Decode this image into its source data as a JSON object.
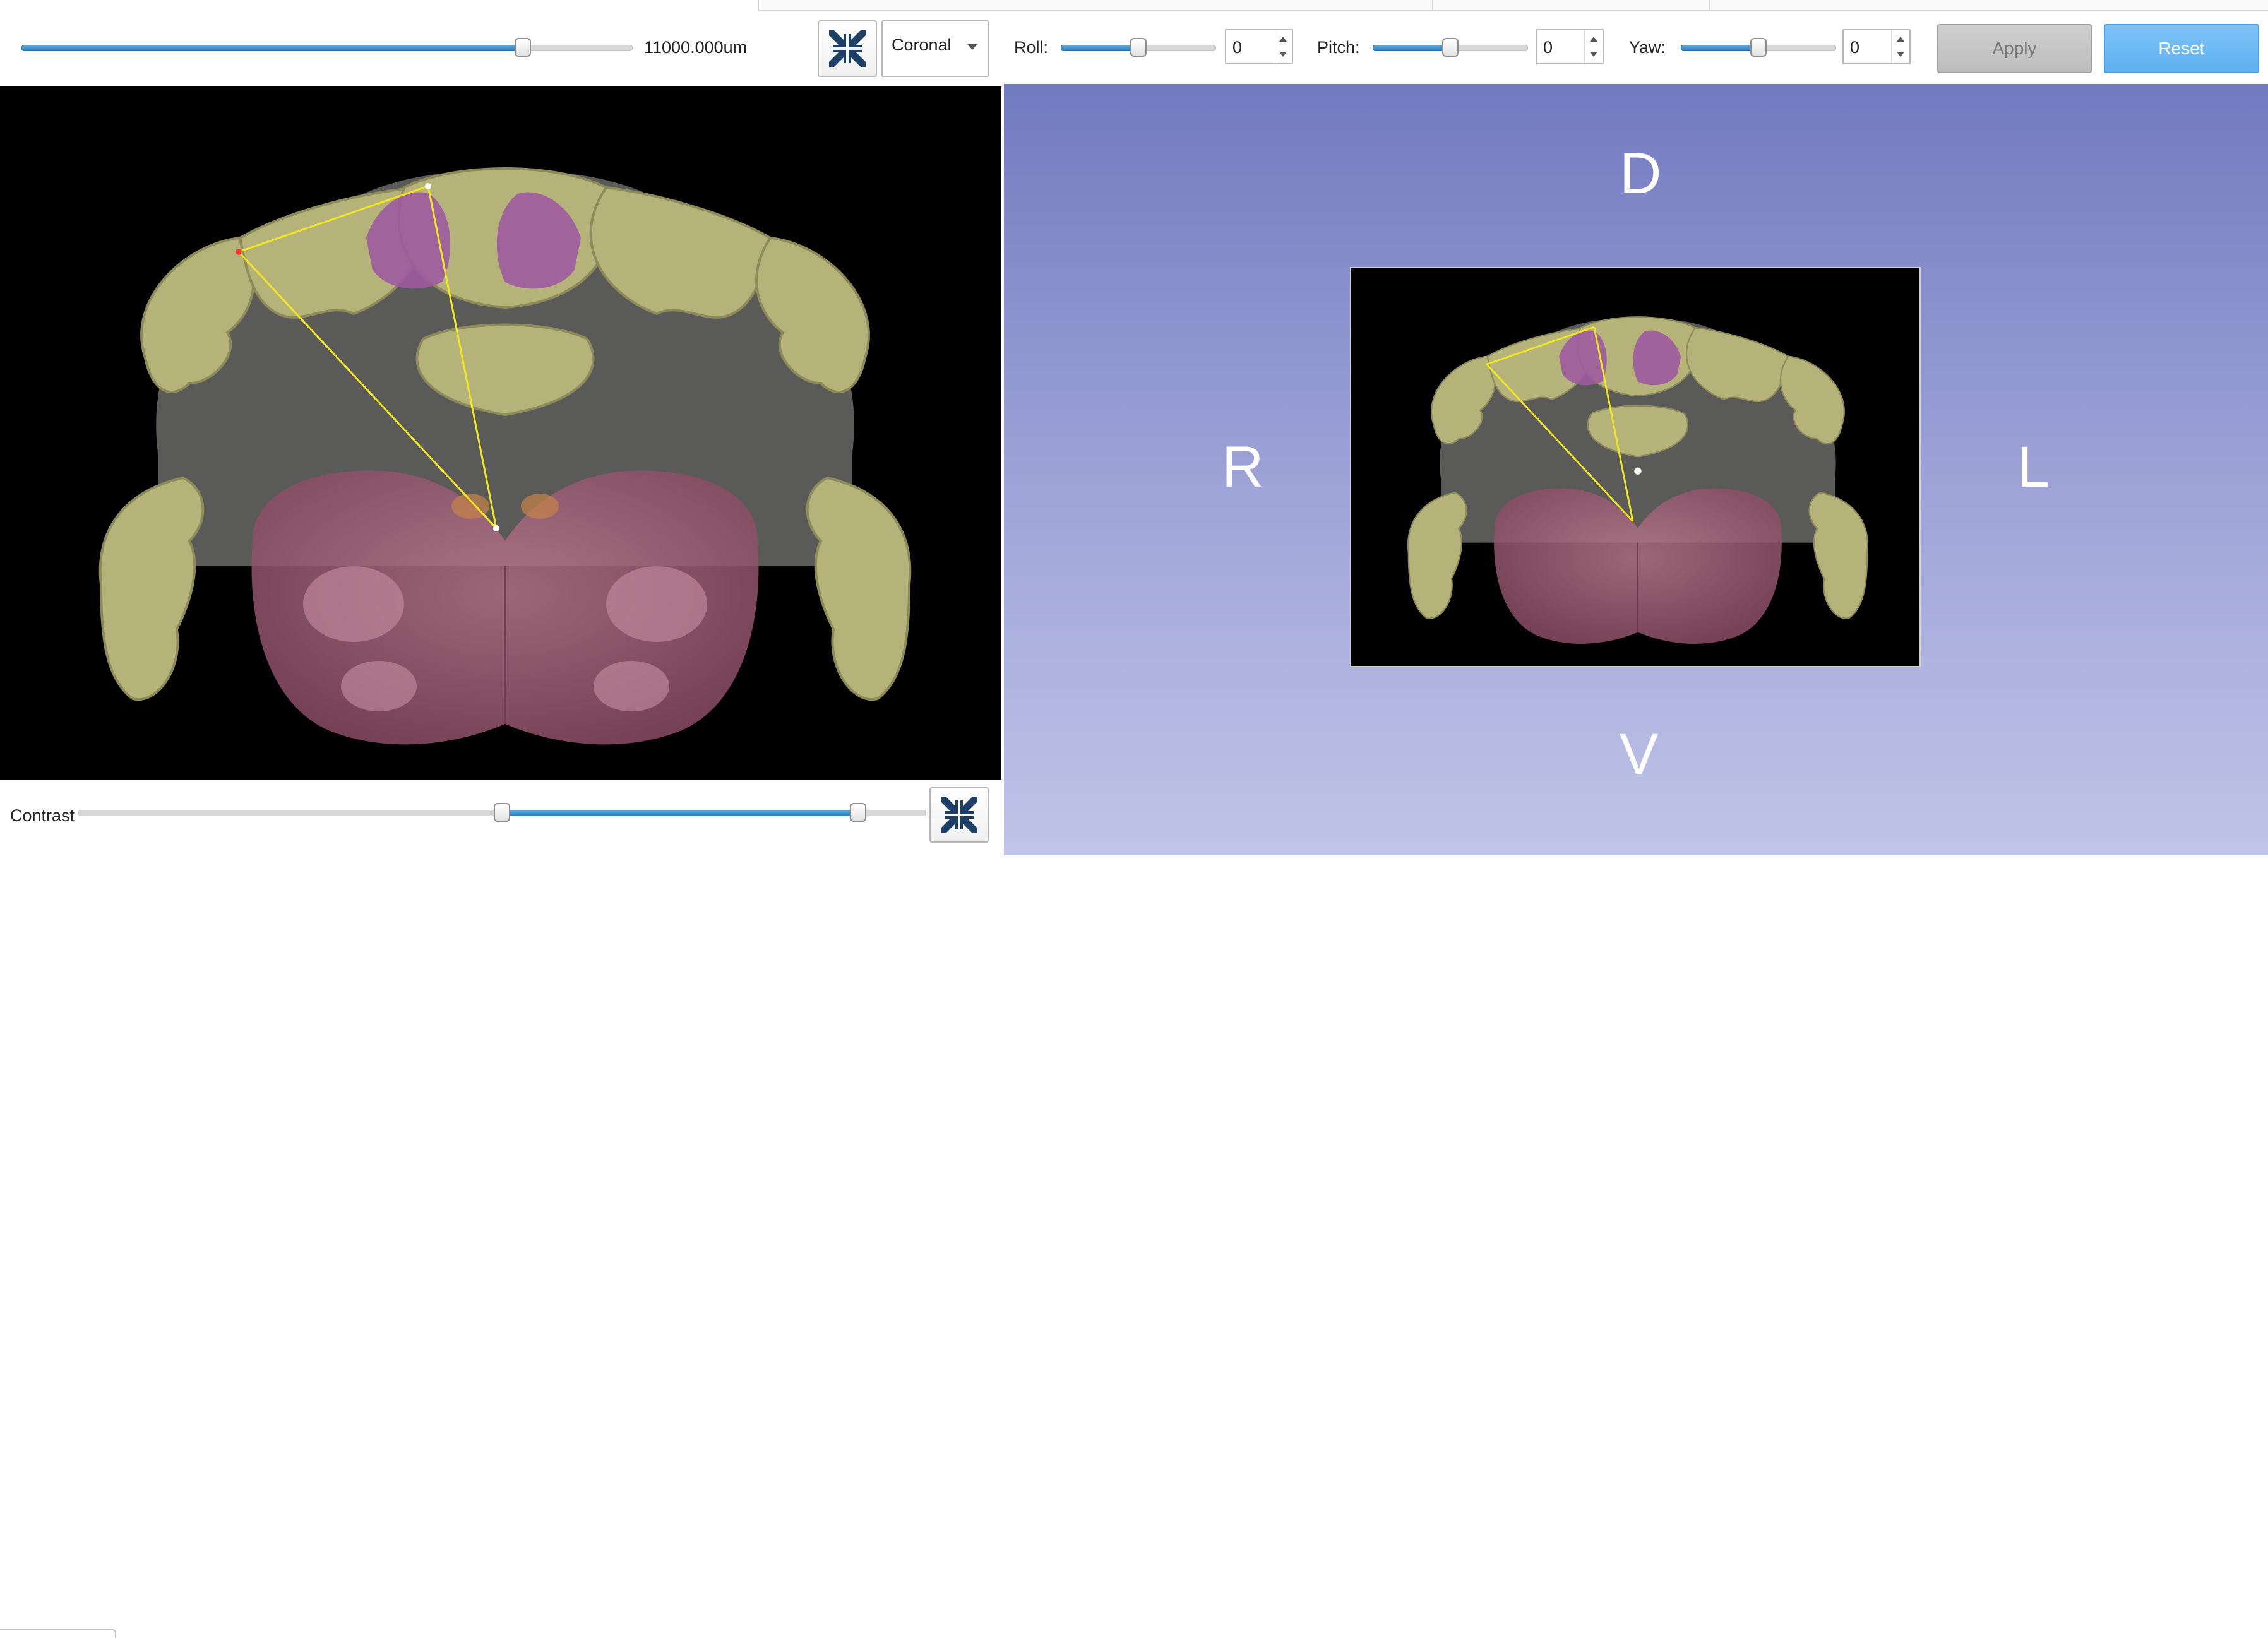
{
  "toolbar": {
    "position_value": "11000.000um",
    "position_level": 0.82,
    "view_options": [
      "Coronal"
    ],
    "selected_view": "Coronal",
    "roll": {
      "label": "Roll:",
      "value": "0",
      "slider_level": 0.5
    },
    "pitch": {
      "label": "Pitch:",
      "value": "0",
      "slider_level": 0.5
    },
    "yaw": {
      "label": "Yaw:",
      "value": "0",
      "slider_level": 0.5
    },
    "apply_label": "Apply",
    "reset_label": "Reset"
  },
  "view3d": {
    "orientation": {
      "dorsal": "D",
      "ventral": "V",
      "right": "R",
      "left": "L"
    }
  },
  "contrast": {
    "label": "Contrast",
    "range": [
      0.5,
      0.92
    ]
  },
  "colors": {
    "accent": "#3b8ed0",
    "reset_button": "#6ab8f4",
    "view3d_top": "#727ac0",
    "view3d_bottom": "#c0c4e8",
    "brain_olive": "#b8b57a",
    "brain_magenta": "#9d5aa0",
    "brain_pink": "#a8687f",
    "measure_line": "#f0e623"
  },
  "icons": {
    "fit_view": "collapse-arrows-icon"
  }
}
